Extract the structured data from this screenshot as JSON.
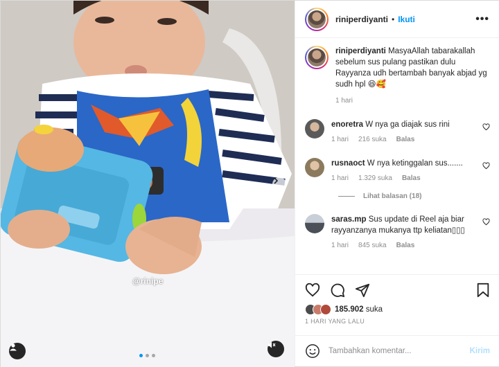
{
  "post": {
    "watermark": "@rinipe"
  },
  "header": {
    "username": "riniperdiyanti",
    "separator": "•",
    "follow_label": "Ikuti",
    "more_label": "•••"
  },
  "caption": {
    "username": "riniperdiyanti",
    "text": "MasyaAllah tabarakallah sebelum sus pulang pastikan dulu Rayyanza udh bertambah banyak abjad yg sudh hpl 😆🥰",
    "time": "1 hari"
  },
  "comments": [
    {
      "username": "enoretra",
      "text": "W nya ga diajak sus rini",
      "time": "1 hari",
      "likes": "216 suka",
      "reply_label": "Balas",
      "avatar_color": "#5a5a5a"
    },
    {
      "username": "rusnaoct",
      "text": "W nya ketinggalan sus.......",
      "time": "1 hari",
      "likes": "1.329 suka",
      "reply_label": "Balas",
      "avatar_color": "#8b7a5d"
    },
    {
      "username": "saras.mp",
      "text": "Sus update di Reel aja biar rayyanzanya mukanya ttp keliatan\u0000\u0000\u0000",
      "text_display": "Sus update di Reel aja biar rayyanzanya mukanya ttp keliatan▯▯▯",
      "time": "1 hari",
      "likes": "845 suka",
      "reply_label": "Balas",
      "avatar_color": "#4a4f58"
    }
  ],
  "view_replies": "Lihat balasan (18)",
  "likes": {
    "count": "185.902",
    "suffix": " suka"
  },
  "date": "1 HARI YANG LALU",
  "add_comment": {
    "placeholder": "Tambahkan komentar...",
    "post_label": "Kirim"
  },
  "colors": {
    "accent": "#0095f6",
    "post_disabled": "#b2dffc",
    "muted": "#8e8e8e"
  },
  "icons": [
    "user-tag-icon",
    "mute-icon",
    "chevron-right-icon",
    "heart-icon",
    "comment-icon",
    "share-icon",
    "bookmark-icon",
    "emoji-icon",
    "more-icon"
  ]
}
